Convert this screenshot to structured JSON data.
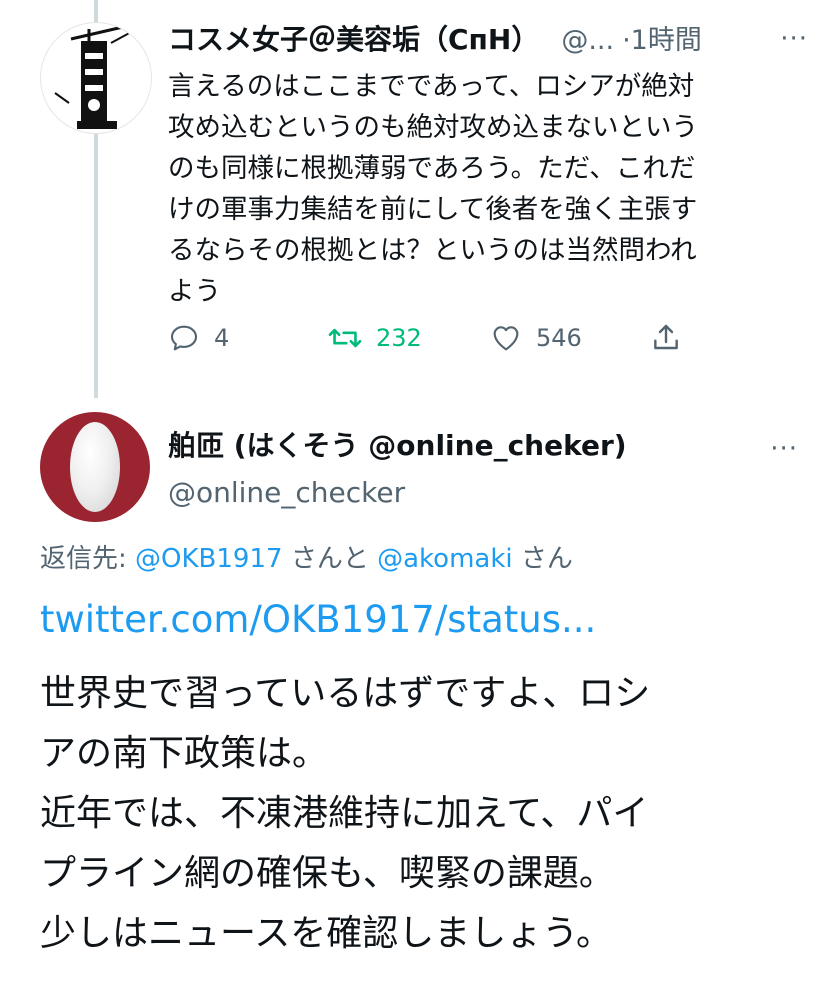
{
  "tweet1": {
    "display_name": "コスメ女子＠美容垢（СпН）",
    "handle": "@...",
    "time": "·1時間",
    "more": "···",
    "text_lines": [
      "言えるのはここまでであって、ロシアが絶対",
      "攻め込むというのも絶対攻め込まないという",
      "のも同様に根拠薄弱であろう。ただ、これだ",
      "けの軍事力集結を前にして後者を強く主張す",
      "るならその根拠とは？というのは当然問われ",
      "よう"
    ],
    "actions": {
      "reply_count": "4",
      "retweet_count": "232",
      "like_count": "546"
    }
  },
  "tweet2": {
    "display_name": "舶匝 (はくそう @online_cheker)",
    "handle": "@online_checker",
    "more": "···",
    "reply_label": "返信先: ",
    "reply_user1": "@OKB1917",
    "reply_mid": " さんと ",
    "reply_user2": "@akomaki",
    "reply_end": " さん",
    "link": "twitter.com/OKB1917/status...",
    "text_lines": [
      "世界史で習っているはずですよ、ロシ",
      "アの南下政策は。",
      "近年では、不凍港維持に加えて、パイ",
      "プライン網の確保も、喫緊の課題。",
      "少しはニュースを確認しましょう。"
    ]
  },
  "colors": {
    "accent": "#1d9bf0",
    "retweet": "#00ba7c",
    "secondary": "#536471",
    "avatar2_bg": "#9a2531"
  }
}
